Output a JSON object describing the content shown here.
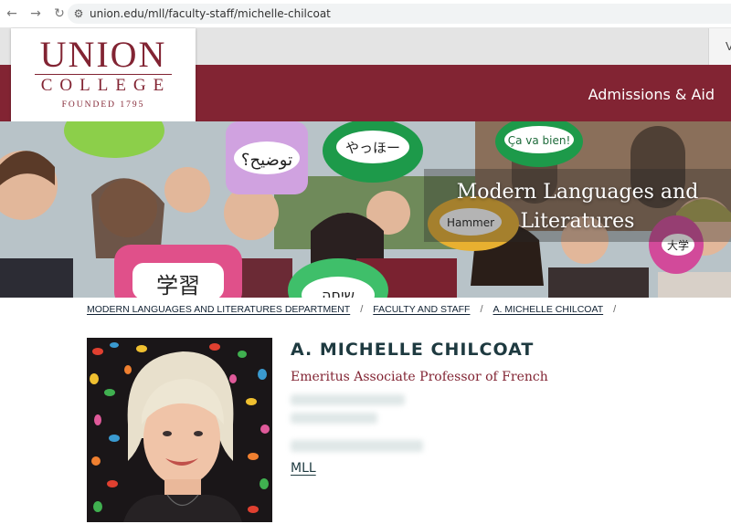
{
  "browser": {
    "url": "union.edu/mll/faculty-staff/michelle-chilcoat"
  },
  "header": {
    "logo_union": "UNION",
    "logo_college": "COLLEGE",
    "logo_founded": "FOUNDED 1795",
    "nav_item": "Admissions & Aid",
    "util_letter": "V"
  },
  "hero": {
    "title_line1": "Modern Languages and",
    "title_line2": "Literatures",
    "sign_texts": [
      "توضيح؟",
      "やっほー",
      "Ça va bien!",
      "Hammer",
      "学習",
      "שיחה",
      "大学"
    ]
  },
  "breadcrumb": {
    "items": [
      "MODERN LANGUAGES AND LITERATURES DEPARTMENT",
      "FACULTY AND STAFF",
      "A. MICHELLE CHILCOAT"
    ],
    "separator": "/"
  },
  "profile": {
    "name": "A. MICHELLE CHILCOAT",
    "title": "Emeritus Associate Professor of French",
    "department_link": "MLL"
  },
  "colors": {
    "maroon": "#822433",
    "heading": "#1e3a40"
  }
}
